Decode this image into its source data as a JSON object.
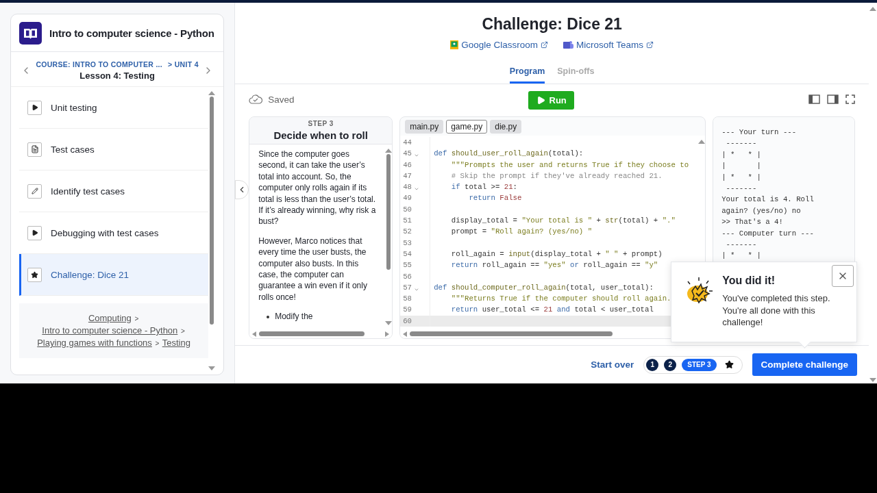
{
  "sidebar": {
    "course_title": "Intro to computer science - Python",
    "course_path": "COURSE: INTRO TO COMPUTER ...",
    "unit": "> UNIT 4",
    "lesson": "Lesson 4: Testing",
    "items": [
      {
        "label": "Unit testing",
        "kind": "video",
        "selected": false
      },
      {
        "label": "Test cases",
        "kind": "article",
        "selected": false
      },
      {
        "label": "Identify test cases",
        "kind": "exercise",
        "selected": false
      },
      {
        "label": "Debugging with test cases",
        "kind": "video",
        "selected": false
      },
      {
        "label": "Challenge: Dice 21",
        "kind": "challenge",
        "selected": true
      }
    ],
    "breadcrumbs": [
      {
        "label": "Computing"
      },
      {
        "label": "Intro to computer science - Python"
      },
      {
        "label": "Playing games with functions"
      },
      {
        "label": "Testing"
      }
    ],
    "separator": ">"
  },
  "main": {
    "title": "Challenge: Dice 21",
    "share_links": [
      {
        "label": "Google Classroom",
        "kind": "classroom"
      },
      {
        "label": "Microsoft Teams",
        "kind": "teams"
      }
    ],
    "tabs": [
      {
        "label": "Program",
        "selected": true
      },
      {
        "label": "Spin-offs",
        "selected": false
      }
    ],
    "save_status": "Saved",
    "run_label": "Run",
    "instructions": {
      "step": "STEP 3",
      "heading": "Decide when to roll",
      "paragraphs": [
        "Since the computer goes second, it can take the user’s total into account. So, the computer only rolls again if its total is less than the user’s total. If it’s already winning, why risk a bust?",
        "However, Marco notices that every time the user busts, the computer also busts. In this case, the computer can guarantee a win even if it only rolls once!"
      ],
      "bullets": [
        "Modify the"
      ]
    },
    "files": [
      {
        "label": "main.py",
        "selected": false
      },
      {
        "label": "game.py",
        "selected": true
      },
      {
        "label": "die.py",
        "selected": false
      }
    ],
    "code": [
      {
        "n": "44",
        "fold": false,
        "current": false
      },
      {
        "n": "45",
        "fold": true,
        "current": false,
        "tokens": [
          {
            "kind": "kw",
            "s": "def"
          },
          {
            "kind": "fn",
            "s": " should_user_roll_again"
          },
          {
            "kind": "plain",
            "s": "(total):"
          }
        ]
      },
      {
        "n": "46",
        "fold": false,
        "current": false,
        "tokens": [
          {
            "kind": "str",
            "s": "    \"\"\"Prompts the user and returns True if they choose to"
          }
        ]
      },
      {
        "n": "47",
        "fold": false,
        "current": false,
        "tokens": [
          {
            "kind": "com",
            "s": "    # Skip the prompt if they've already reached 21."
          }
        ]
      },
      {
        "n": "48",
        "fold": true,
        "current": false,
        "tokens": [
          {
            "kind": "kw",
            "s": "    if"
          },
          {
            "kind": "plain",
            "s": " total >= "
          },
          {
            "kind": "num",
            "s": "21"
          },
          {
            "kind": "plain",
            "s": ":"
          }
        ]
      },
      {
        "n": "49",
        "fold": false,
        "current": false,
        "tokens": [
          {
            "kind": "kw",
            "s": "        return"
          },
          {
            "kind": "num",
            "s": " False"
          }
        ]
      },
      {
        "n": "50",
        "fold": false,
        "current": false
      },
      {
        "n": "51",
        "fold": false,
        "current": false,
        "tokens": [
          {
            "kind": "plain",
            "s": "    display_total = "
          },
          {
            "kind": "str",
            "s": "\"Your total is \""
          },
          {
            "kind": "plain",
            "s": " + "
          },
          {
            "kind": "fn",
            "s": "str"
          },
          {
            "kind": "plain",
            "s": "(total) + "
          },
          {
            "kind": "str",
            "s": "\".\""
          }
        ]
      },
      {
        "n": "52",
        "fold": false,
        "current": false,
        "tokens": [
          {
            "kind": "plain",
            "s": "    prompt = "
          },
          {
            "kind": "str",
            "s": "\"Roll again? (yes/no) \""
          }
        ]
      },
      {
        "n": "53",
        "fold": false,
        "current": false
      },
      {
        "n": "54",
        "fold": false,
        "current": false,
        "tokens": [
          {
            "kind": "plain",
            "s": "    roll_again = "
          },
          {
            "kind": "fn",
            "s": "input"
          },
          {
            "kind": "plain",
            "s": "(display_total + "
          },
          {
            "kind": "str",
            "s": "\" \""
          },
          {
            "kind": "plain",
            "s": " + prompt)"
          }
        ]
      },
      {
        "n": "55",
        "fold": false,
        "current": false,
        "tokens": [
          {
            "kind": "kw",
            "s": "    return"
          },
          {
            "kind": "plain",
            "s": " roll_again == "
          },
          {
            "kind": "str",
            "s": "\"yes\""
          },
          {
            "kind": "kw",
            "s": " or"
          },
          {
            "kind": "plain",
            "s": " roll_again == "
          },
          {
            "kind": "str",
            "s": "\"y\""
          }
        ]
      },
      {
        "n": "56",
        "fold": false,
        "current": false
      },
      {
        "n": "57",
        "fold": true,
        "current": false,
        "tokens": [
          {
            "kind": "kw",
            "s": "def"
          },
          {
            "kind": "fn",
            "s": " should_computer_roll_again"
          },
          {
            "kind": "plain",
            "s": "(total, user_total):"
          }
        ]
      },
      {
        "n": "58",
        "fold": false,
        "current": false,
        "tokens": [
          {
            "kind": "str",
            "s": "    \"\"\"Returns True if the computer should roll again."
          }
        ]
      },
      {
        "n": "59",
        "fold": false,
        "current": false,
        "tokens": [
          {
            "kind": "kw",
            "s": "    return"
          },
          {
            "kind": "plain",
            "s": " user_total <= "
          },
          {
            "kind": "num",
            "s": "21"
          },
          {
            "kind": "kw",
            "s": " and"
          },
          {
            "kind": "plain",
            "s": " total < user_total"
          }
        ]
      },
      {
        "n": "60",
        "fold": false,
        "current": true
      }
    ],
    "output": [
      "--- Your turn ---",
      " -------",
      "| *   * |",
      "|       |",
      "| *   * |",
      " -------",
      "Your total is 4. Roll",
      "again? (yes/no) no",
      ">> That's a 4!",
      "--- Computer turn ---",
      " -------",
      "| *   * |"
    ],
    "toast": {
      "title": "You did it!",
      "message": "You've completed this step. You're all done with this challenge!"
    },
    "start_over": "Start over",
    "steps": [
      {
        "label": "1",
        "kind": "number",
        "completed": true,
        "selected": false
      },
      {
        "label": "2",
        "kind": "number",
        "completed": true,
        "selected": false
      },
      {
        "label": "STEP 3",
        "kind": "number",
        "completed": false,
        "selected": true
      },
      {
        "kind": "star",
        "completed": false,
        "selected": false
      }
    ],
    "complete_label": "Complete challenge"
  }
}
